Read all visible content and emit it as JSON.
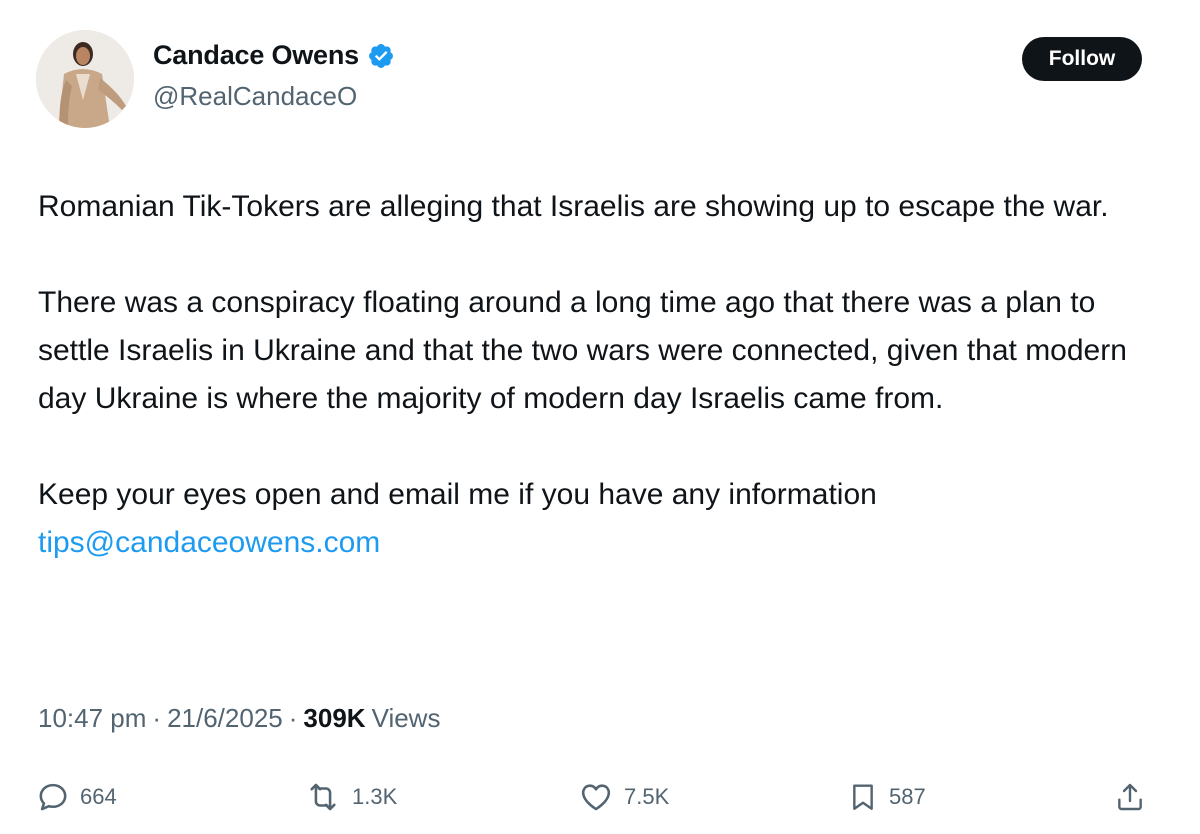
{
  "author": {
    "display_name": "Candace Owens",
    "handle": "@RealCandaceO",
    "verified": true,
    "verified_color": "#1d9bf0"
  },
  "follow_button": {
    "label": "Follow"
  },
  "tweet": {
    "paragraphs": [
      "Romanian Tik-Tokers are alleging that Israelis are showing up to escape the war.",
      "There was a conspiracy floating around a long time ago that there was a plan to settle Israelis in Ukraine and that the two wars were connected, given that modern day Ukraine is where the majority of modern day Israelis came from.",
      "Keep your eyes open and email me if you have any information"
    ],
    "email_link": "tips@candaceowens.com"
  },
  "meta": {
    "time": "10:47 pm",
    "date": "21/6/2025",
    "separator": "·",
    "views_count": "309K",
    "views_label": "Views"
  },
  "actions": {
    "replies": "664",
    "reposts": "1.3K",
    "likes": "7.5K",
    "bookmarks": "587"
  },
  "icons": {
    "reply": "reply-icon",
    "repost": "repost-icon",
    "like": "heart-icon",
    "bookmark": "bookmark-icon",
    "share": "share-icon",
    "verified": "verified-badge-icon"
  },
  "colors": {
    "text_primary": "#0f1419",
    "text_secondary": "#536471",
    "link": "#1d9bf0",
    "follow_bg": "#0f1419",
    "follow_text": "#ffffff"
  }
}
